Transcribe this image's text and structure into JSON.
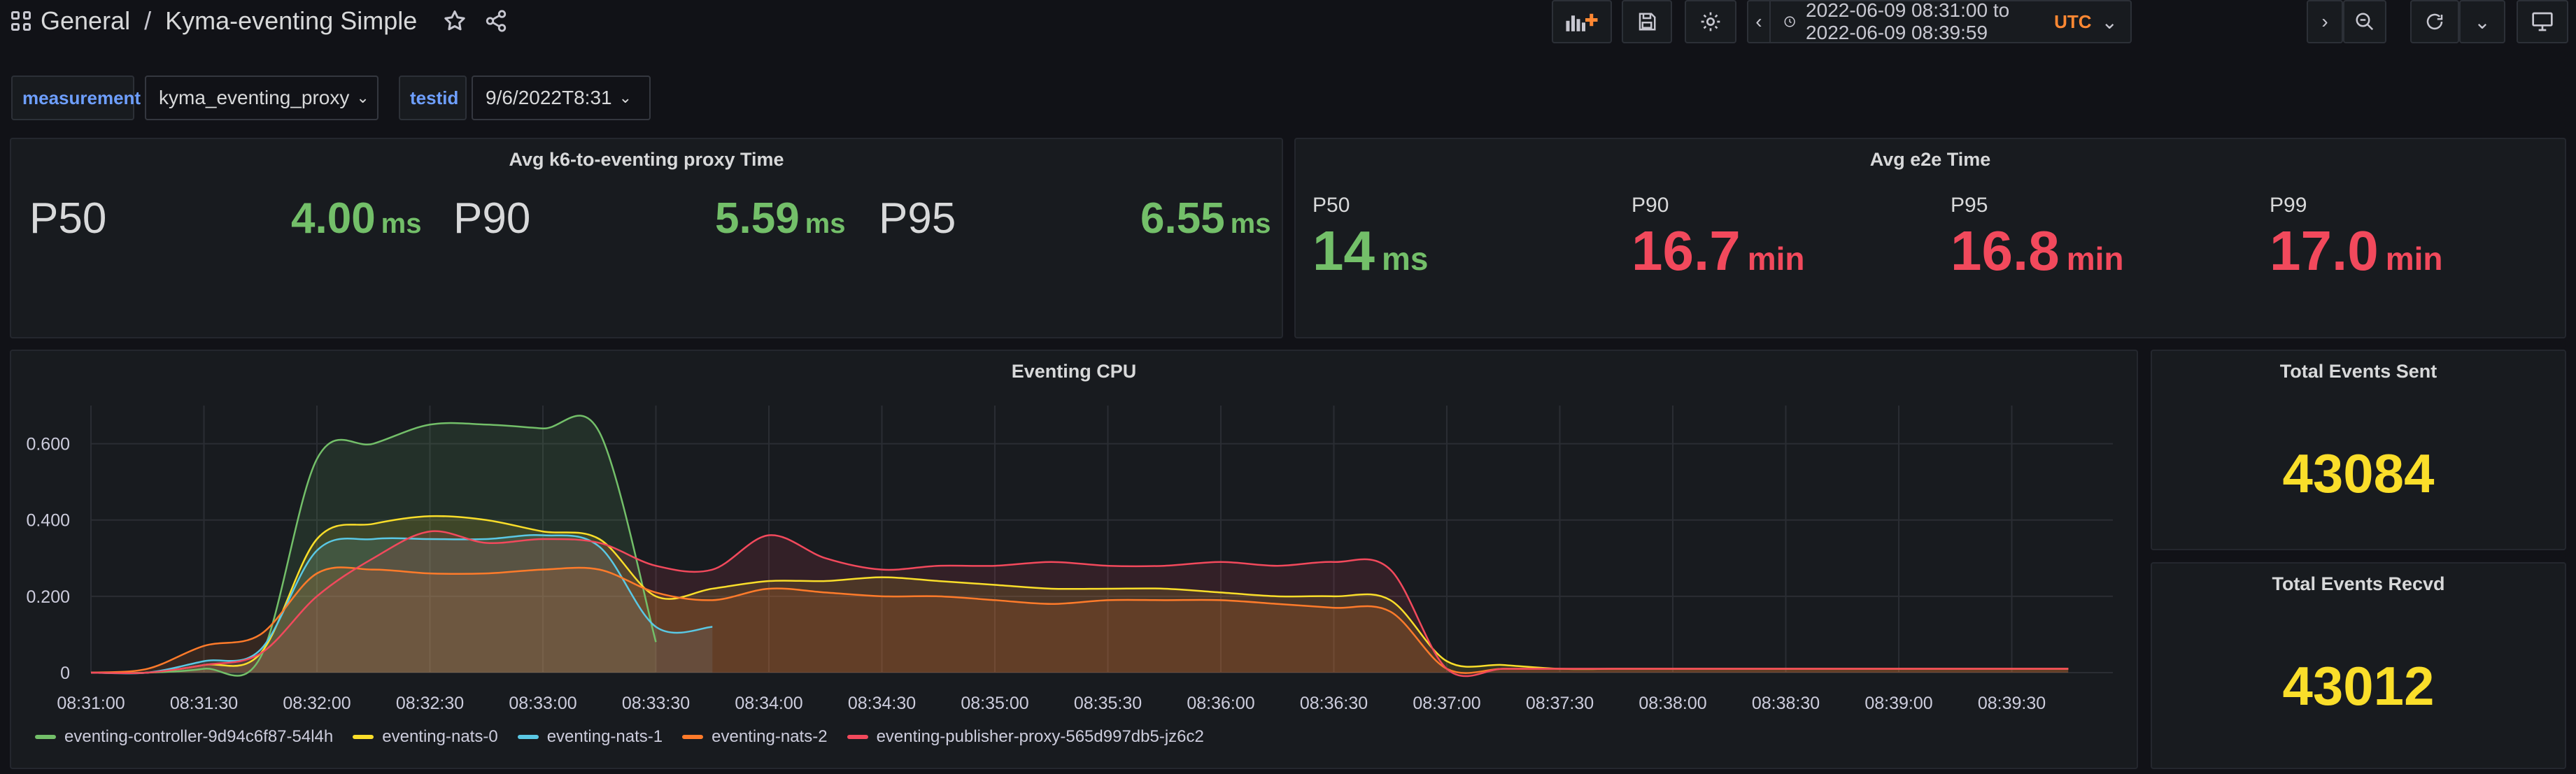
{
  "nav": {
    "section": "General",
    "separator": "/",
    "dashboard": "Kyma-eventing Simple"
  },
  "toolbar": {
    "time_range": "2022-06-09 08:31:00 to 2022-06-09 08:39:59",
    "timezone": "UTC"
  },
  "variables": [
    {
      "label": "measurement",
      "value": "kyma_eventing_proxy"
    },
    {
      "label": "testid",
      "value": "9/6/2022T8:31"
    }
  ],
  "proxy_panel": {
    "title": "Avg k6-to-eventing proxy Time",
    "stats": [
      {
        "name": "P50",
        "value": "4.00",
        "unit": "ms"
      },
      {
        "name": "P90",
        "value": "5.59",
        "unit": "ms"
      },
      {
        "name": "P95",
        "value": "6.55",
        "unit": "ms"
      }
    ]
  },
  "e2e_panel": {
    "title": "Avg e2e Time",
    "stats": [
      {
        "name": "P50",
        "value": "14",
        "unit": "ms"
      },
      {
        "name": "P90",
        "value": "16.7",
        "unit": "min"
      },
      {
        "name": "P95",
        "value": "16.8",
        "unit": "min"
      },
      {
        "name": "P99",
        "value": "17.0",
        "unit": "min"
      }
    ]
  },
  "sent_panel": {
    "title": "Total Events Sent",
    "value": "43084"
  },
  "recvd_panel": {
    "title": "Total Events Recvd",
    "value": "43012"
  },
  "colors": {
    "green": "#73bf69",
    "red": "#f2495c",
    "yellow": "#fade2a",
    "blue": "#6e9fff"
  },
  "chart_data": {
    "type": "area",
    "title": "Eventing CPU",
    "xlabel": "",
    "ylabel": "",
    "ylim": [
      0,
      0.7
    ],
    "y_ticks": [
      "0",
      "0.200",
      "0.400",
      "0.600"
    ],
    "y_tick_values": [
      0,
      0.2,
      0.4,
      0.6
    ],
    "x_ticks": [
      "08:31:00",
      "08:31:30",
      "08:32:00",
      "08:32:30",
      "08:33:00",
      "08:33:30",
      "08:34:00",
      "08:34:30",
      "08:35:00",
      "08:35:30",
      "08:36:00",
      "08:36:30",
      "08:37:00",
      "08:37:30",
      "08:38:00",
      "08:38:30",
      "08:39:00",
      "08:39:30"
    ],
    "grid": true,
    "legend_position": "bottom-left",
    "x": [
      "08:31:00",
      "08:31:15",
      "08:31:30",
      "08:31:45",
      "08:32:00",
      "08:32:15",
      "08:32:30",
      "08:32:45",
      "08:33:00",
      "08:33:15",
      "08:33:30",
      "08:33:45",
      "08:34:00",
      "08:34:15",
      "08:34:30",
      "08:34:45",
      "08:35:00",
      "08:35:15",
      "08:35:30",
      "08:35:45",
      "08:36:00",
      "08:36:15",
      "08:36:30",
      "08:36:45",
      "08:37:00",
      "08:37:15",
      "08:37:30",
      "08:37:45",
      "08:38:00",
      "08:38:15",
      "08:38:30",
      "08:38:45",
      "08:39:00",
      "08:39:15",
      "08:39:30",
      "08:39:45"
    ],
    "series": [
      {
        "name": "eventing-controller-9d94c6f87-54l4h",
        "color": "#73bf69",
        "values": [
          0,
          0,
          0.01,
          0.04,
          0.56,
          0.6,
          0.65,
          0.65,
          0.64,
          0.63,
          0.08,
          null,
          null,
          null,
          null,
          null,
          null,
          null,
          null,
          null,
          null,
          null,
          null,
          null,
          null,
          null,
          null,
          null,
          null,
          null,
          null,
          null,
          null,
          null,
          null,
          null
        ]
      },
      {
        "name": "eventing-nats-0",
        "color": "#fade2a",
        "values": [
          0,
          0,
          0.02,
          0.05,
          0.35,
          0.39,
          0.41,
          0.4,
          0.37,
          0.35,
          0.2,
          0.22,
          0.24,
          0.24,
          0.25,
          0.24,
          0.23,
          0.22,
          0.22,
          0.22,
          0.21,
          0.2,
          0.2,
          0.19,
          0.03,
          0.02,
          0.01,
          0.01,
          0.01,
          0.01,
          0.01,
          0.01,
          0.01,
          0.01,
          0.01,
          0.01
        ]
      },
      {
        "name": "eventing-nats-1",
        "color": "#5ac8e4",
        "values": [
          0,
          0,
          0.03,
          0.06,
          0.32,
          0.35,
          0.35,
          0.35,
          0.36,
          0.33,
          0.12,
          0.12,
          null,
          null,
          null,
          null,
          null,
          null,
          null,
          null,
          null,
          null,
          null,
          null,
          null,
          null,
          null,
          null,
          null,
          null,
          null,
          null,
          null,
          null,
          null,
          null
        ]
      },
      {
        "name": "eventing-nats-2",
        "color": "#ff7b2a",
        "values": [
          0,
          0.01,
          0.07,
          0.1,
          0.26,
          0.27,
          0.26,
          0.26,
          0.27,
          0.27,
          0.21,
          0.19,
          0.22,
          0.21,
          0.2,
          0.2,
          0.19,
          0.18,
          0.19,
          0.19,
          0.19,
          0.18,
          0.17,
          0.16,
          0.01,
          0.01,
          0.01,
          0.01,
          0.01,
          0.01,
          0.01,
          0.01,
          0.01,
          0.01,
          0.01,
          0.01
        ]
      },
      {
        "name": "eventing-publisher-proxy-565d997db5-jz6c2",
        "color": "#f2495c",
        "values": [
          0,
          0,
          0.02,
          0.05,
          0.2,
          0.3,
          0.37,
          0.34,
          0.35,
          0.34,
          0.28,
          0.27,
          0.36,
          0.3,
          0.27,
          0.28,
          0.28,
          0.29,
          0.28,
          0.28,
          0.29,
          0.28,
          0.29,
          0.27,
          0.01,
          0.01,
          0.01,
          0.01,
          0.01,
          0.01,
          0.01,
          0.01,
          0.01,
          0.01,
          0.01,
          0.01
        ]
      }
    ]
  }
}
